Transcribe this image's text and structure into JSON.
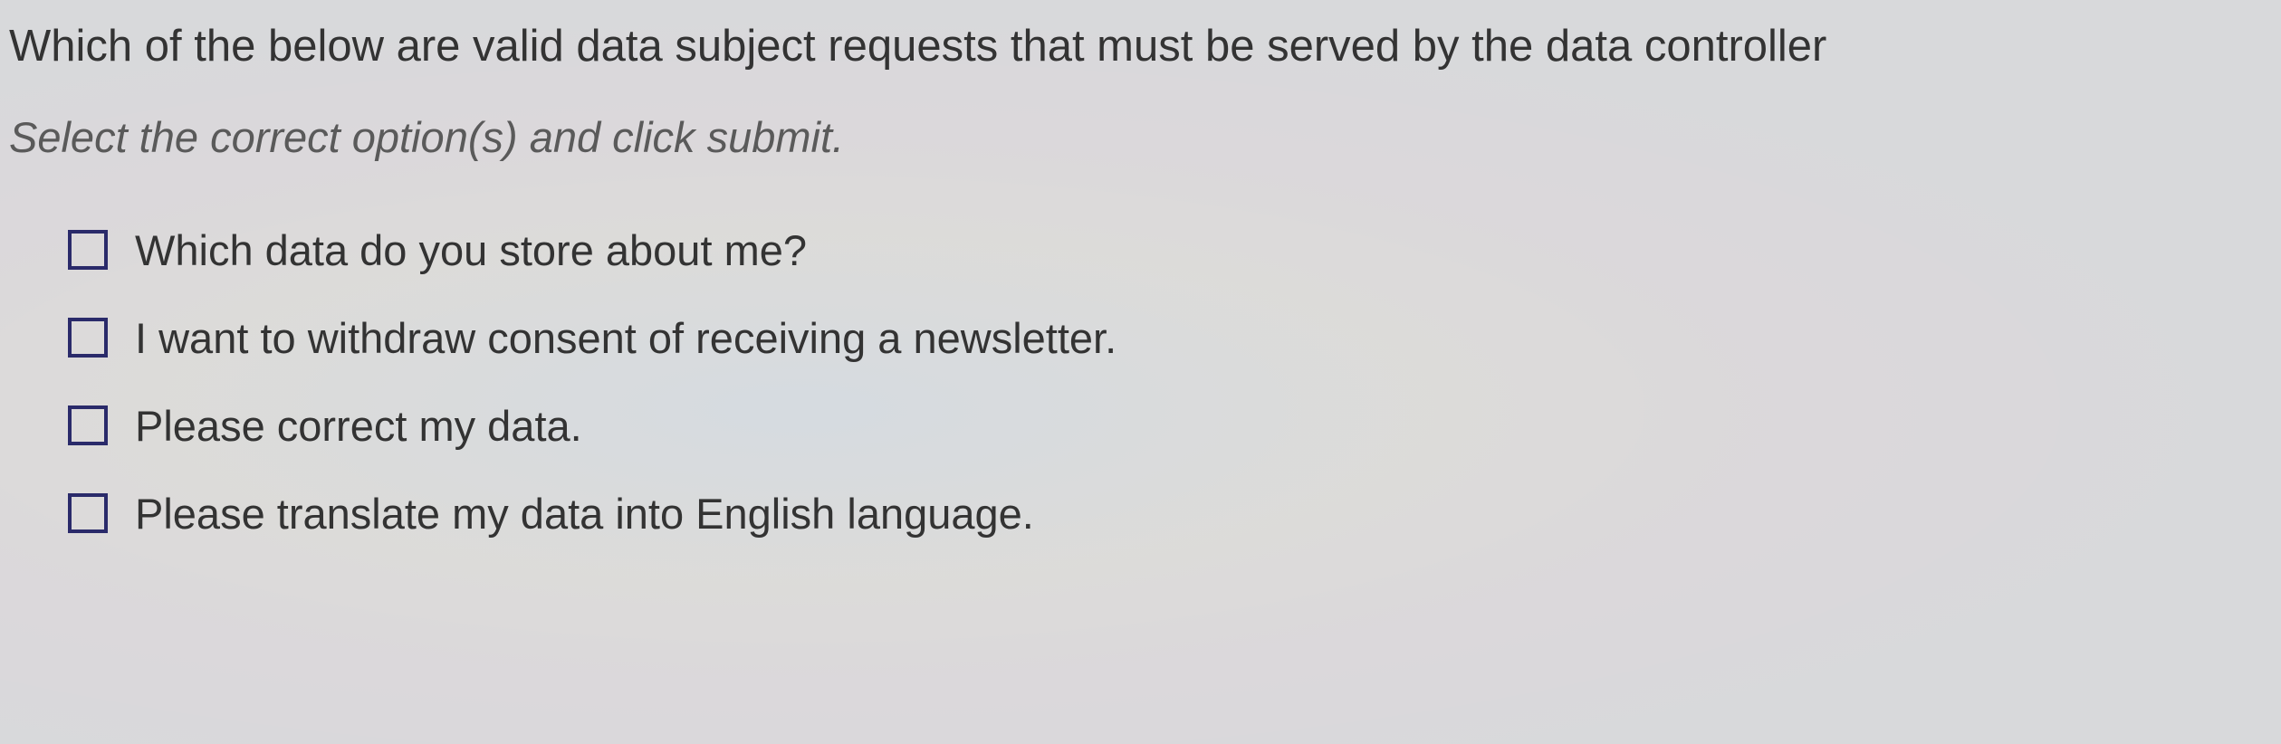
{
  "question": "Which of the below are valid data subject requests that must be served by the data controller",
  "instruction": "Select the correct option(s) and click submit.",
  "options": [
    {
      "label": "Which data do you store about me?"
    },
    {
      "label": "I want to withdraw consent of receiving a newsletter."
    },
    {
      "label": "Please correct my data."
    },
    {
      "label": "Please translate my data into English language."
    }
  ]
}
